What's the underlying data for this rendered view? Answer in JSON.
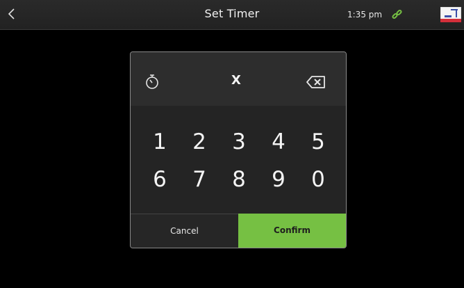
{
  "header": {
    "back_icon": "chevron-left-icon",
    "title": "Set Timer",
    "time": "1:35 pm",
    "status_icon": "link-icon",
    "flag_icon": "flag-icon",
    "accent_color": "#76c043"
  },
  "dialog": {
    "timer_icon": "stopwatch-icon",
    "value": "X",
    "backspace_icon": "backspace-icon",
    "keys_row1": [
      "1",
      "2",
      "3",
      "4",
      "5"
    ],
    "keys_row2": [
      "6",
      "7",
      "8",
      "9",
      "0"
    ],
    "cancel_label": "Cancel",
    "confirm_label": "Confirm"
  }
}
